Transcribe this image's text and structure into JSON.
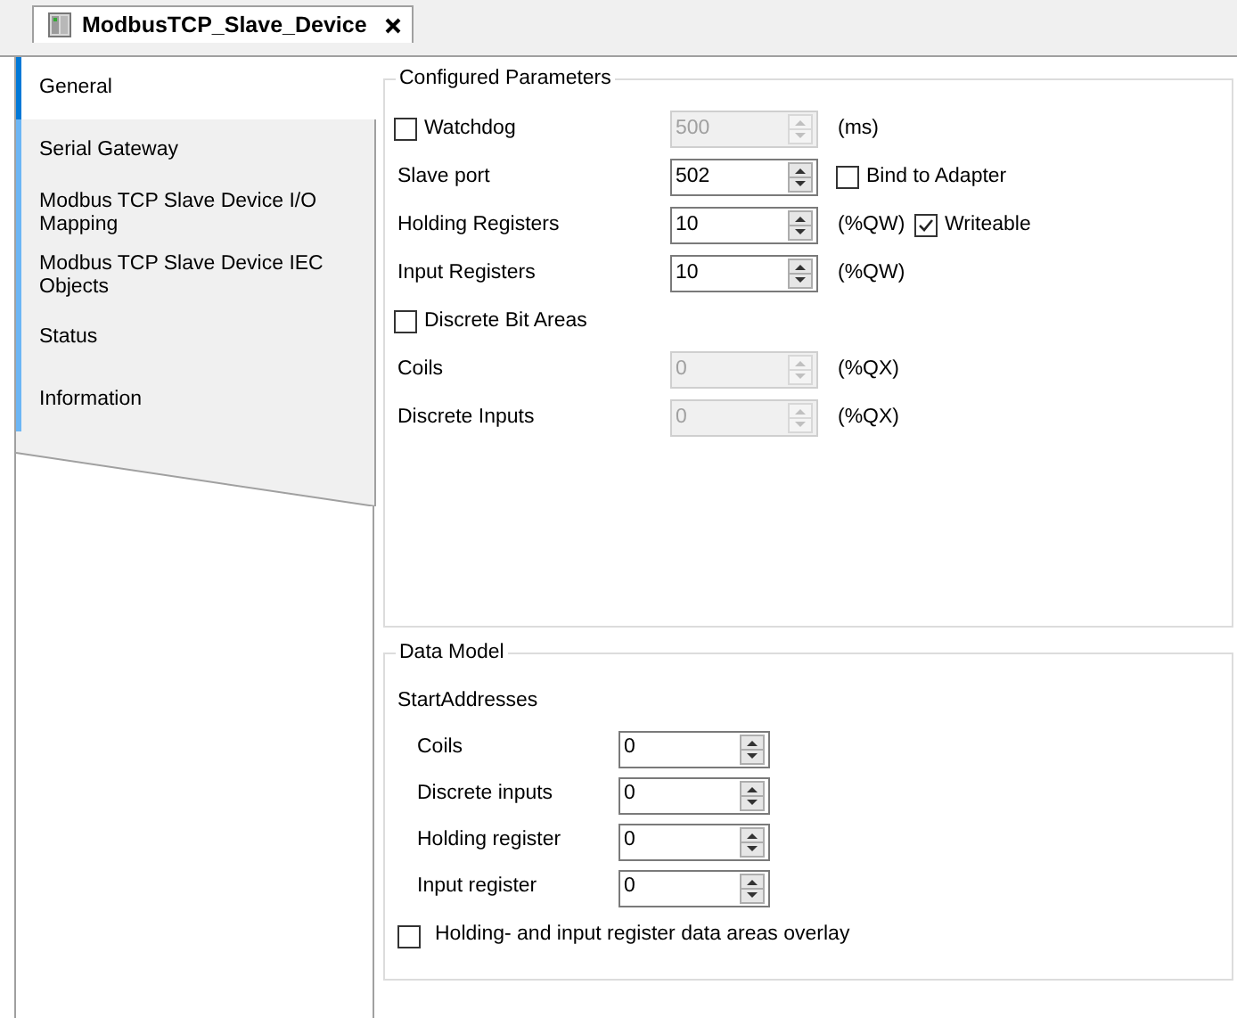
{
  "editor_tab": {
    "title": "ModbusTCP_Slave_Device",
    "selected": true
  },
  "sidebar": {
    "items": [
      {
        "label": "General",
        "selected": true
      },
      {
        "label": "Serial Gateway",
        "selected": false
      },
      {
        "label": "Modbus TCP Slave Device I/O Mapping",
        "selected": false
      },
      {
        "label": "Modbus TCP Slave Device IEC Objects",
        "selected": false
      },
      {
        "label": "Status",
        "selected": false
      },
      {
        "label": "Information",
        "selected": false
      }
    ]
  },
  "configured_parameters": {
    "title": "Configured Parameters",
    "rows": [
      {
        "kind": "check_spin",
        "label": "Watchdog",
        "checked": false,
        "value": "500",
        "disabled": true,
        "unit": "(ms)"
      },
      {
        "kind": "spin",
        "label": "Slave port",
        "value": "502",
        "disabled": false,
        "extra": {
          "label": "Bind to Adapter",
          "checked": false
        }
      },
      {
        "kind": "spin",
        "label": "Holding Registers",
        "value": "10",
        "disabled": false,
        "unit": "(%QW)",
        "extra": {
          "label": "Writeable",
          "checked": true
        }
      },
      {
        "kind": "spin",
        "label": "Input Registers",
        "value": "10",
        "disabled": false,
        "unit": "(%QW)"
      },
      {
        "kind": "check",
        "label": "Discrete Bit Areas",
        "checked": false
      },
      {
        "kind": "spin",
        "label": "Coils",
        "value": "0",
        "disabled": true,
        "unit": "(%QX)"
      },
      {
        "kind": "spin",
        "label": "Discrete Inputs",
        "value": "0",
        "disabled": true,
        "unit": "(%QX)"
      }
    ]
  },
  "data_model": {
    "title": "Data Model",
    "subtitle": "StartAddresses",
    "rows": [
      {
        "label": "Coils",
        "value": "0",
        "disabled": false
      },
      {
        "label": "Discrete inputs",
        "value": "0",
        "disabled": false
      },
      {
        "label": "Holding register",
        "value": "0",
        "disabled": false
      },
      {
        "label": "Input register",
        "value": "0",
        "disabled": false
      }
    ],
    "overlay": {
      "label": "Holding- and input register data areas overlay",
      "checked": false
    }
  }
}
